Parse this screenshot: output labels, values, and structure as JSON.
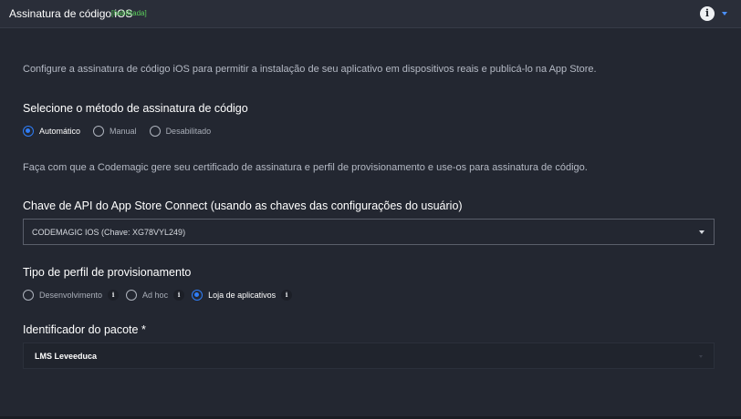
{
  "header": {
    "title": "Assinatura de código iOS",
    "badge": "[habilitada]",
    "info_icon": "i"
  },
  "description": "Configure a assinatura de código iOS para permitir a instalação de seu aplicativo em dispositivos reais e publicá-lo na App Store.",
  "signing_method": {
    "title": "Selecione o método de assinatura de código",
    "options": [
      "Automático",
      "Manual",
      "Desabilitado"
    ],
    "selected": "Automático",
    "help": "Faça com que a Codemagic gere seu certificado de assinatura e perfil de provisionamento e use-os para assinatura de código."
  },
  "api_key": {
    "title": "Chave de API do App Store Connect (usando as chaves das configurações do usuário)",
    "value": "CODEMAGIC IOS (Chave: XG78VYL249)"
  },
  "profile_type": {
    "title": "Tipo de perfil de provisionamento",
    "options": [
      "Desenvolvimento",
      "Ad hoc",
      "Loja de aplicativos"
    ],
    "selected": "Loja de aplicativos",
    "info_icon": "i"
  },
  "bundle_id": {
    "title": "Identificador do pacote *",
    "value": "LMS Leveeduca"
  },
  "colors": {
    "background": "#232731",
    "accent": "#2f7df6",
    "enabled_badge": "#5bd15b"
  }
}
